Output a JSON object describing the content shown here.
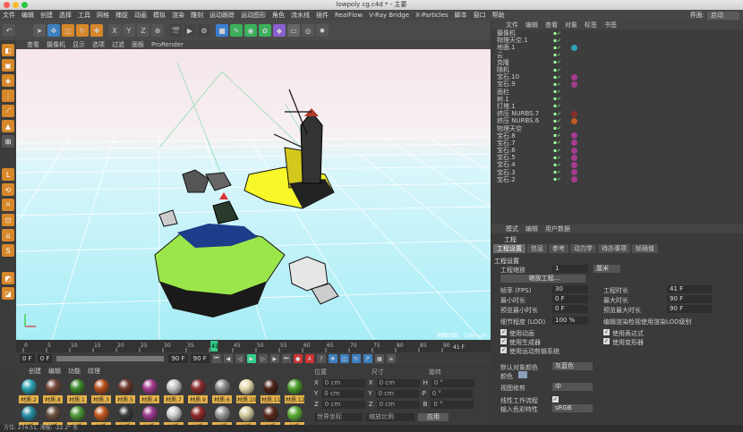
{
  "window": {
    "title": "lowpoly cg.c4d * - 主要"
  },
  "menubar": [
    "文件",
    "编辑",
    "创建",
    "选择",
    "工具",
    "网格",
    "捕捉",
    "动画",
    "模拟",
    "渲染",
    "雕刻",
    "运动跟踪",
    "运动图形",
    "角色",
    "流水线",
    "插件",
    "RealFlow",
    "V-Ray Bridge",
    "X-Particles",
    "脚本",
    "窗口",
    "帮助"
  ],
  "interface": {
    "label": "界面:",
    "value": "启动"
  },
  "viewport": {
    "menu": [
      "查看",
      "摄像机",
      "显示",
      "选项",
      "过滤",
      "面板",
      "ProRender"
    ],
    "grid_label": "网格间距 : 1000 cm"
  },
  "timeline": {
    "ticks": [
      "0",
      "5",
      "10",
      "15",
      "20",
      "25",
      "30",
      "35",
      "40",
      "45",
      "50",
      "55",
      "60",
      "65",
      "70",
      "75",
      "80",
      "85",
      "90"
    ],
    "current": "41",
    "end_label": "41 F"
  },
  "playbar": {
    "start": "0 F",
    "field2": "0 F",
    "end": "90 F",
    "end2": "90 F"
  },
  "materials": {
    "menu": [
      "创建",
      "编辑",
      "功能",
      "纹理"
    ],
    "items": [
      {
        "label": "材质.2",
        "color": "#2fa3b3"
      },
      {
        "label": "材质.8",
        "color": "#7a4a3c"
      },
      {
        "label": "材质.1",
        "color": "#3d8a2e"
      },
      {
        "label": "材质.3",
        "color": "#b8501e"
      },
      {
        "label": "材质.5",
        "color": "#6b3a2a"
      },
      {
        "label": "材质.4",
        "color": "#a33c8f"
      },
      {
        "label": "材质.7",
        "color": "#c7c7c7"
      },
      {
        "label": "材质.9",
        "color": "#8a2f2f"
      },
      {
        "label": "材质.6",
        "color": "#8a8a8a"
      },
      {
        "label": "材质.10",
        "color": "#e8dcb0"
      },
      {
        "label": "材质.11",
        "color": "#4b2418"
      },
      {
        "label": "材质.12",
        "color": "#4e9e2c"
      },
      {
        "label": "材质",
        "color": "#2b8fa8"
      },
      {
        "label": "材质",
        "color": "#6a5040"
      },
      {
        "label": "材质",
        "color": "#4f9a3a"
      },
      {
        "label": "材质",
        "color": "#c05a22"
      },
      {
        "label": "材质",
        "color": "#3b3b3b"
      },
      {
        "label": "材质",
        "color": "#9c3a8f"
      },
      {
        "label": "材质",
        "color": "#d0d0d0"
      },
      {
        "label": "材质",
        "color": "#902a2a"
      },
      {
        "label": "材质",
        "color": "#999999"
      },
      {
        "label": "材质",
        "color": "#d8cda0"
      },
      {
        "label": "材质",
        "color": "#5a2a1a"
      },
      {
        "label": "材质",
        "color": "#5cae38"
      }
    ]
  },
  "coords": {
    "headers": [
      "位置",
      "尺寸",
      "旋转"
    ],
    "rows": [
      {
        "a": "X",
        "v1": "0 cm",
        "b": "X",
        "v2": "0 cm",
        "c": "H",
        "v3": "0 °"
      },
      {
        "a": "Y",
        "v1": "0 cm",
        "b": "Y",
        "v2": "0 cm",
        "c": "P",
        "v3": "0 °"
      },
      {
        "a": "Z",
        "v1": "0 cm",
        "b": "Z",
        "v2": "0 cm",
        "c": "B",
        "v3": "0 °"
      }
    ],
    "mode1": "世界坐标",
    "mode2": "缩放比例",
    "apply": "应用"
  },
  "status": {
    "text": "方位: 274.51, 海拔: -22.2° 东"
  },
  "object_manager": {
    "menu": [
      "文件",
      "编辑",
      "查看",
      "对象",
      "标签",
      "书签"
    ],
    "objects": [
      {
        "name": "摄像机",
        "tag": ""
      },
      {
        "name": "物理天空.1",
        "tag": ""
      },
      {
        "name": "地面.1",
        "tag": "#2fa3b3"
      },
      {
        "name": "云",
        "tag": ""
      },
      {
        "name": "克隆",
        "tag": ""
      },
      {
        "name": "随机",
        "tag": ""
      },
      {
        "name": "宝石.10",
        "tag": "#a33c8f"
      },
      {
        "name": "宝石.9",
        "tag": "#a33c8f"
      },
      {
        "name": "面栏",
        "tag": ""
      },
      {
        "name": "树.1",
        "tag": ""
      },
      {
        "name": "灯塔.1",
        "tag": ""
      },
      {
        "name": "挤压 NURBS.7",
        "tag": "#8a2f2f"
      },
      {
        "name": "挤压 NURBS.6",
        "tag": "#c05a22"
      },
      {
        "name": "物理天空",
        "tag": ""
      },
      {
        "name": "宝石.8",
        "tag": "#a33c8f"
      },
      {
        "name": "宝石.7",
        "tag": "#a33c8f"
      },
      {
        "name": "宝石.6",
        "tag": "#a33c8f"
      },
      {
        "name": "宝石.5",
        "tag": "#a33c8f"
      },
      {
        "name": "宝石.4",
        "tag": "#a33c8f"
      },
      {
        "name": "宝石.3",
        "tag": "#a33c8f"
      },
      {
        "name": "宝石.2",
        "tag": "#a33c8f"
      }
    ]
  },
  "attributes": {
    "menu": [
      "模式",
      "编辑",
      "用户数据"
    ],
    "header": "工程",
    "tabs": [
      "工程设置",
      "信息",
      "参考",
      "动力学",
      "待办事项",
      "帧插值"
    ],
    "section": "工程设置",
    "scale_label": "工程缩放",
    "scale_value": "1",
    "scale_unit": "厘米",
    "scale_button": "缩放工程...",
    "fps_label": "帧率 (FPS)",
    "fps_value": "30",
    "project_time_label": "工程时长",
    "project_time_value": "41 F",
    "min_time_label": "最小时长",
    "min_time_value": "0 F",
    "max_time_label": "最大时长",
    "max_time_value": "90 F",
    "preview_min_label": "预览最小时长",
    "preview_min_value": "0 F",
    "preview_max_label": "预览最大时长",
    "preview_max_value": "90 F",
    "lod_label": "细节程度 (LOD)",
    "lod_value": "100 %",
    "lod_render": "编辑渲染检视使用渲染LOD级别",
    "checks_left": [
      "使用动画",
      "使用生成器",
      "使用运动剪辑系统"
    ],
    "checks_right": [
      "使用表达式",
      "使用变形器"
    ],
    "default_color_label": "默认对象颜色",
    "default_color_value": "灰蓝色",
    "color_label": "颜色",
    "view_clip_label": "视图修剪",
    "view_clip_value": "中",
    "linear_label": "线性工作流程",
    "input_color_label": "输入色彩特性",
    "input_color_value": "sRGB"
  }
}
